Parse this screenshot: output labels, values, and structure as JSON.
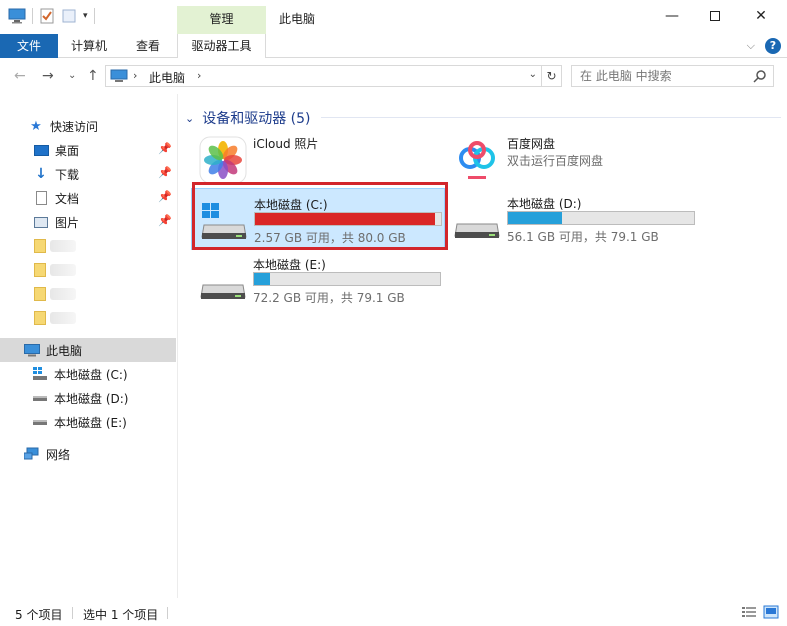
{
  "window": {
    "title": "此电脑",
    "context_group": "管理"
  },
  "ribbon": {
    "file_tab": "文件",
    "tabs": [
      "计算机",
      "查看"
    ],
    "drive_tools_tab": "驱动器工具"
  },
  "address": {
    "crumb": "此电脑",
    "search_placeholder": "在 此电脑 中搜索"
  },
  "nav": {
    "quick_access": "快速访问",
    "pinned": [
      {
        "label": "桌面",
        "icon": "desktop-icon"
      },
      {
        "label": "下载",
        "icon": "download-icon"
      },
      {
        "label": "文档",
        "icon": "document-icon"
      },
      {
        "label": "图片",
        "icon": "pictures-icon"
      }
    ],
    "this_pc": "此电脑",
    "drives": [
      "本地磁盘 (C:)",
      "本地磁盘 (D:)",
      "本地磁盘 (E:)"
    ],
    "network": "网络"
  },
  "content": {
    "group_title": "设备和驱动器 (5)",
    "tiles": {
      "icloud": {
        "name": "iCloud 照片"
      },
      "baidu": {
        "name": "百度网盘",
        "sub": "双击运行百度网盘"
      },
      "c": {
        "name": "本地磁盘 (C:)",
        "free": "2.57 GB 可用，共 80.0 GB",
        "used_fraction": 0.968,
        "bar_color": "#da2626"
      },
      "d": {
        "name": "本地磁盘 (D:)",
        "free": "56.1 GB 可用，共 79.1 GB",
        "used_fraction": 0.29,
        "bar_color": "#26a0da"
      },
      "e": {
        "name": "本地磁盘 (E:)",
        "free": "72.2 GB 可用，共 79.1 GB",
        "used_fraction": 0.087,
        "bar_color": "#26a0da"
      }
    }
  },
  "status": {
    "count": "5 个项目",
    "selected": "选中 1 个项目"
  }
}
